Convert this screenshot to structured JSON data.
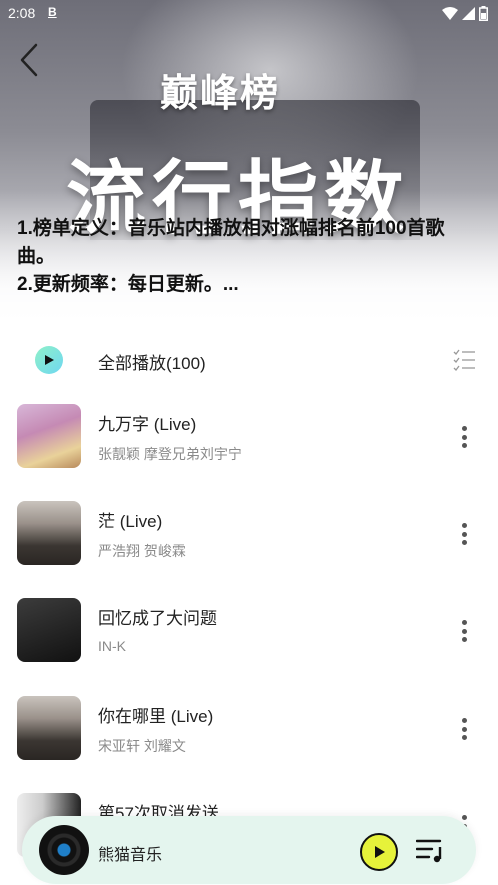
{
  "status": {
    "time": "2:08",
    "b_icon": "B"
  },
  "header": {
    "brand": "巅峰榜",
    "title": "流行指数",
    "description_line1": "1.榜单定义：音乐站内播放相对涨幅排名前100首歌曲。",
    "description_line2": "2.更新频率：每日更新。..."
  },
  "play_all": {
    "label": "全部播放(100)"
  },
  "songs": [
    {
      "title": "九万字 (Live)",
      "artist": "张靓颖 摩登兄弟刘宇宁"
    },
    {
      "title": "茫 (Live)",
      "artist": "严浩翔 贺峻霖"
    },
    {
      "title": "回忆成了大问题",
      "artist": "IN-K"
    },
    {
      "title": "你在哪里 (Live)",
      "artist": "宋亚轩 刘耀文"
    },
    {
      "title": "第57次取消发送",
      "artist": ""
    }
  ],
  "player": {
    "name": "熊猫音乐"
  },
  "colors": {
    "accent": "#e6f23a",
    "player_bg": "#e4f5ee",
    "play_all_gradient": "#6fd7f0"
  },
  "icons": [
    "back-arrow-icon",
    "play-icon",
    "multiselect-icon",
    "more-icon",
    "playlist-icon",
    "wifi-icon",
    "signal-icon",
    "battery-icon"
  ]
}
